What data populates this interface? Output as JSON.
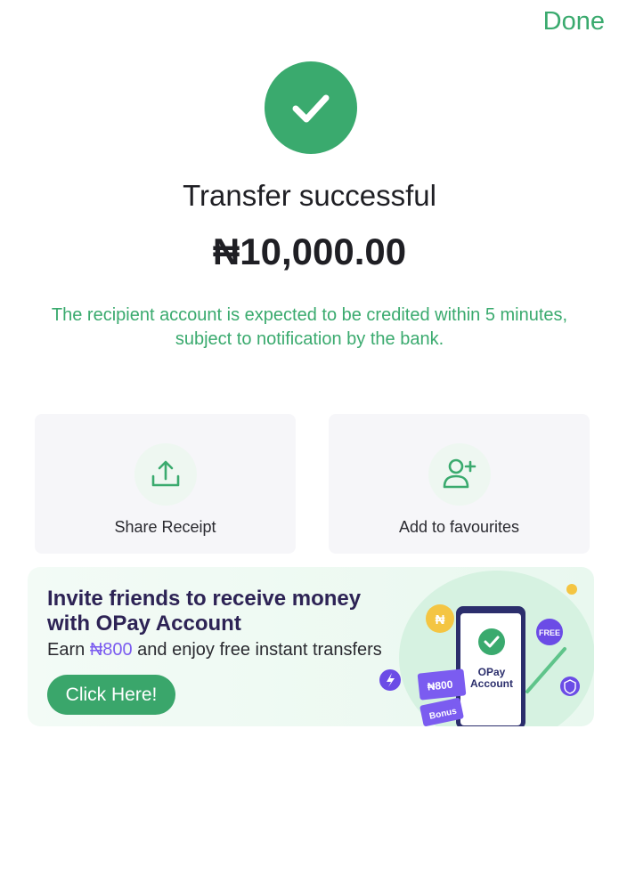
{
  "header": {
    "done_label": "Done"
  },
  "status": {
    "title": "Transfer successful",
    "amount": "₦10,000.00",
    "note": "The recipient account is expected to be credited within 5 minutes, subject to notification by the bank."
  },
  "actions": [
    {
      "label": "Share Receipt",
      "icon": "share-icon"
    },
    {
      "label": "Add to favourites",
      "icon": "add-user-icon"
    }
  ],
  "banner": {
    "title_line1": "Invite friends to receive money",
    "title_line2": "with OPay Account",
    "sub_prefix": "Earn ",
    "sub_amount": "₦800",
    "sub_suffix": " and enjoy free instant transfers",
    "button_label": "Click Here!",
    "art": {
      "badge_free": "FREE",
      "phone_line1": "OPay",
      "phone_line2": "Account",
      "ticket_amount": "₦800",
      "ticket_label": "Bonus"
    }
  },
  "colors": {
    "accent": "#3aaa6e",
    "text": "#1f1f24",
    "banner_title": "#2d2355",
    "highlight": "#7b5cf0"
  }
}
